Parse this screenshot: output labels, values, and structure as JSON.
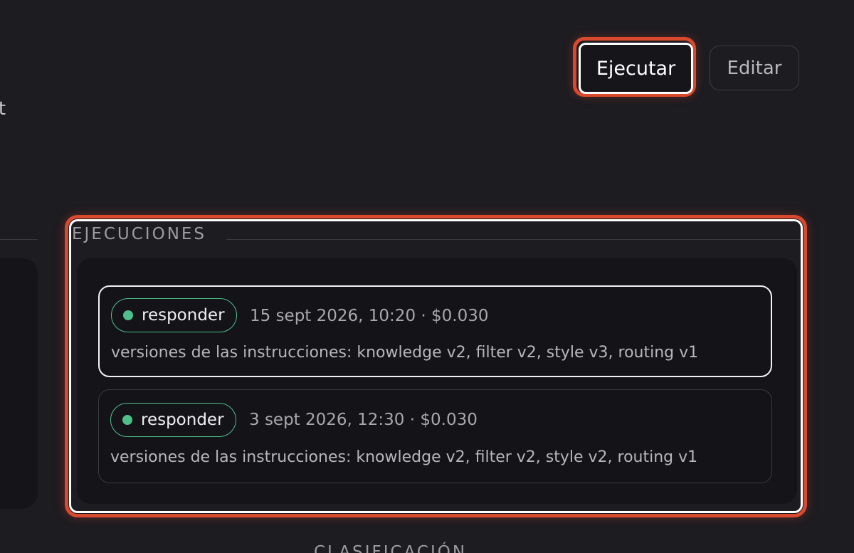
{
  "header": {
    "clipped_text": "ot"
  },
  "actions": {
    "run_label": "Ejecutar",
    "edit_label": "Editar"
  },
  "executions": {
    "title": "EJECUCIONES",
    "runs": [
      {
        "status": "responder",
        "meta": "15 sept 2026, 10:20 · $0.030",
        "versions": "versiones de las instrucciones: knowledge v2, filter v2, style v3, routing v1",
        "selected": true
      },
      {
        "status": "responder",
        "meta": "3 sept 2026, 12:30 · $0.030",
        "versions": "versiones de las instrucciones: knowledge v2, filter v2, style v2, routing v1",
        "selected": false
      }
    ]
  },
  "next_section": {
    "title": "CLASIFICACIÓN"
  },
  "colors": {
    "background": "#1d1c21",
    "panel": "#151418",
    "highlight": "#d9492d",
    "status_green": "#4fbf8a"
  }
}
